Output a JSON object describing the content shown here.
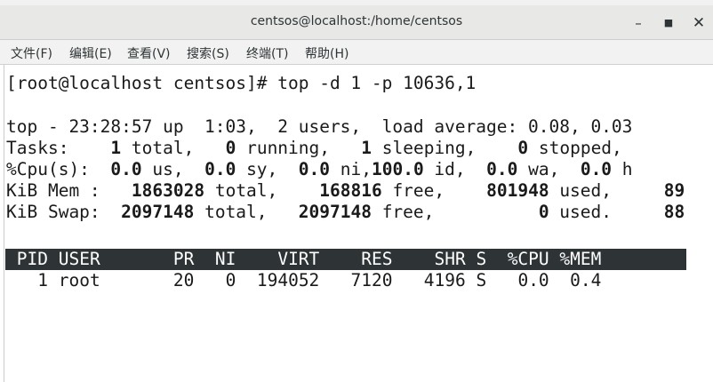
{
  "window": {
    "title": "centsos@localhost:/home/centsos",
    "buttons": {
      "minimize": "–",
      "maximize": "■",
      "close": "✕"
    }
  },
  "menu": [
    "文件(F)",
    "编辑(E)",
    "查看(V)",
    "搜索(S)",
    "终端(T)",
    "帮助(H)"
  ],
  "terminal": {
    "prompt_line": "[root@localhost centsos]# top -d 1 -p 10636,1",
    "summary": {
      "top_line": "top - 23:28:57 up  1:03,  2 users,  load average: 0.08, 0.03",
      "tasks": {
        "label": "Tasks:",
        "total": "1",
        "total_lbl": " total,",
        "running": "0",
        "running_lbl": " running,",
        "sleeping": "1",
        "sleeping_lbl": " sleeping,",
        "stopped": "0",
        "stopped_lbl": " stopped,"
      },
      "cpu": {
        "label": "%Cpu(s):",
        "us": "0.0",
        "us_lbl": " us,",
        "sy": "0.0",
        "sy_lbl": " sy,",
        "ni": "0.0",
        "ni_lbl": " ni,",
        "id": "100.0",
        "id_lbl": " id,",
        "wa": "0.0",
        "wa_lbl": " wa,",
        "hi": "0.0",
        "hi_lbl": " h"
      },
      "mem": {
        "label": "KiB Mem :",
        "total": "1863028",
        "total_lbl": " total,",
        "free": "168816",
        "free_lbl": " free,",
        "used": "801948",
        "used_lbl": " used,",
        "tail": "89"
      },
      "swap": {
        "label": "KiB Swap:",
        "total": "2097148",
        "total_lbl": " total,",
        "free": "2097148",
        "free_lbl": " free,",
        "used": "0",
        "used_lbl": " used.",
        "tail": "88"
      }
    },
    "table": {
      "headers": [
        "PID",
        "USER",
        "PR",
        "NI",
        "VIRT",
        "RES",
        "SHR",
        "S",
        "%CPU",
        "%MEM"
      ],
      "rows": [
        [
          "1",
          "root",
          "20",
          "0",
          "194052",
          "7120",
          "4196",
          "S",
          "0.0",
          "0.4"
        ]
      ]
    }
  }
}
